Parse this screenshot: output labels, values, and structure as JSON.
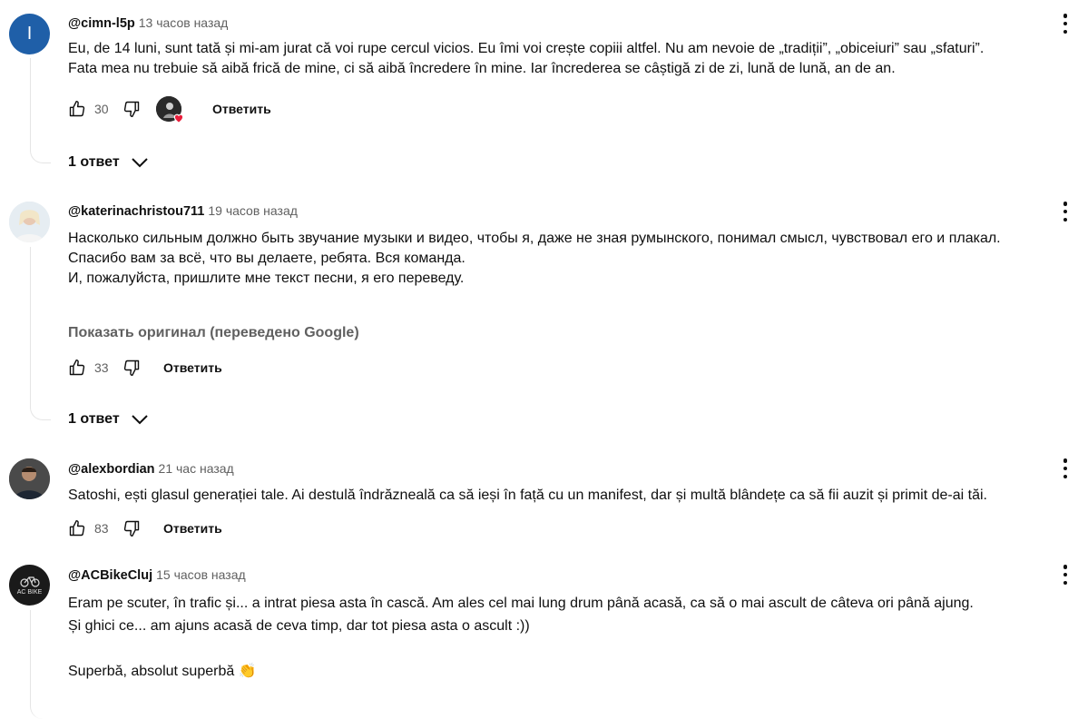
{
  "comments": [
    {
      "author": "@cimn-l5p",
      "avatar_letter": "I",
      "time": "13 часов назад",
      "lines": [
        "Eu, de 14 luni, sunt tată și mi-am jurat că voi rupe cercul vicios. Eu îmi voi crește copiii altfel. Nu am nevoie de „tradiții”, „obiceiuri” sau „sfaturi”.",
        "Fata mea nu trebuie să aibă frică de mine, ci să aibă încredere în mine. Iar încrederea se câștigă zi de zi, lună de lună, an de an."
      ],
      "likes": "30",
      "reply_label": "Ответить",
      "replies_label": "1 ответ"
    },
    {
      "author": "@katerinachristou711",
      "time": "19 часов назад",
      "lines": [
        "Насколько сильным должно быть звучание музыки и видео, чтобы я, даже не зная румынского, понимал смысл, чувствовал его и плакал.",
        "Спасибо вам за всё, что вы делаете, ребята. Вся команда.",
        "И, пожалуйста, пришлите мне текст песни, я его переведу."
      ],
      "translate_label": "Показать оригинал (переведено Google)",
      "likes": "33",
      "reply_label": "Ответить",
      "replies_label": "1 ответ"
    },
    {
      "author": "@alexbordian",
      "time": "21 час назад",
      "lines": [
        "Satoshi, ești glasul generației tale. Ai destulă îndrăzneală ca să ieși în față cu un manifest, dar și multă blândețe ca să fii auzit și primit de-ai tăi."
      ],
      "likes": "83",
      "reply_label": "Ответить"
    },
    {
      "author": "@ACBikeCluj",
      "avatar_text": "AC BIKE",
      "time": "15 часов назад",
      "lines": [
        "Eram pe scuter, în trafic și... a intrat piesa asta în cască. Am ales cel mai lung drum până acasă, ca să o mai ascult de câteva ori până ajung.",
        "Și ghici ce... am ajuns acasă de ceva timp, dar tot piesa asta o ascult :))",
        "",
        "Superbă, absolut superbă 👏"
      ]
    }
  ],
  "colors": {
    "accent_avatar": "#1f5fa8",
    "heart": "#e91e3b",
    "secondary_text": "#606060"
  }
}
